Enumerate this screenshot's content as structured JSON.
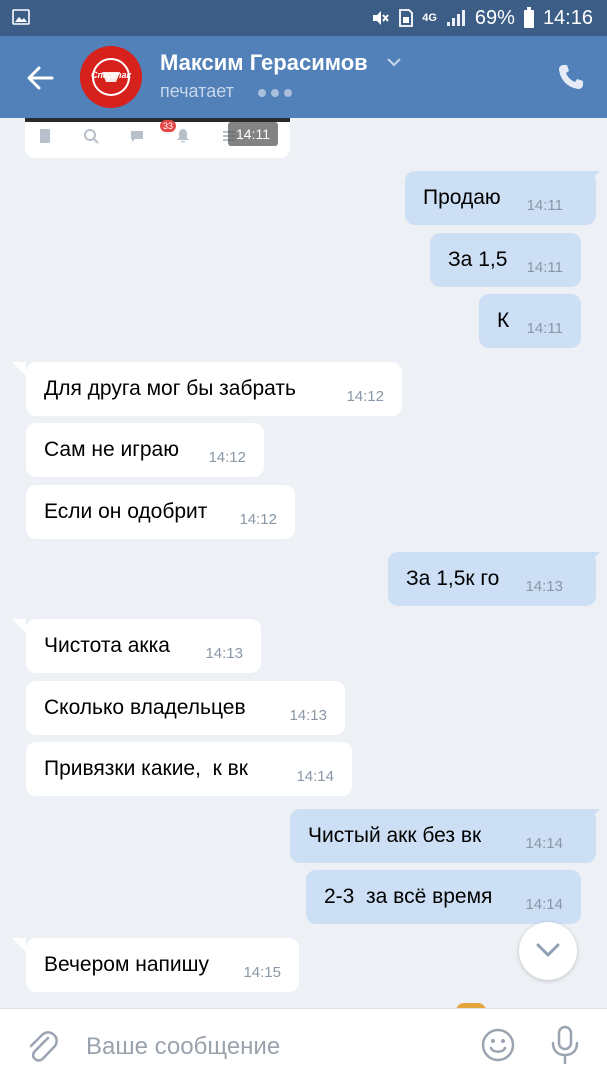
{
  "status_bar": {
    "network": "4G",
    "battery": "69%",
    "time": "14:16",
    "icons": [
      "image-icon",
      "mute-icon",
      "sim-icon",
      "signal-icon",
      "battery-icon"
    ]
  },
  "header": {
    "contact_name": "Максим Герасимов",
    "status": "печатает",
    "avatar_text": "Спартак",
    "icons": [
      "back-arrow-icon",
      "chevron-down-icon",
      "phone-icon"
    ]
  },
  "preview": {
    "badge": "33",
    "time": "14:11",
    "icons": [
      "news-icon",
      "search-icon",
      "messages-icon",
      "bell-icon",
      "menu-icon"
    ]
  },
  "messages": [
    {
      "dir": "out",
      "text": "Продаю",
      "time": "14:11"
    },
    {
      "dir": "out",
      "text": "За 1,5",
      "time": "14:11"
    },
    {
      "dir": "out",
      "text": "К",
      "time": "14:11"
    },
    {
      "dir": "in",
      "text": "Для друга мог бы забрать",
      "time": "14:12"
    },
    {
      "dir": "in",
      "text": "Сам не играю",
      "time": "14:12"
    },
    {
      "dir": "in",
      "text": "Если он одобрит",
      "time": "14:12"
    },
    {
      "dir": "out",
      "text": "За 1,5к го",
      "time": "14:13"
    },
    {
      "dir": "in",
      "text": "Чистота акка",
      "time": "14:13"
    },
    {
      "dir": "in",
      "text": "Сколько владельцев",
      "time": "14:13"
    },
    {
      "dir": "in",
      "text": "Привязки какие,  к вк",
      "time": "14:14"
    },
    {
      "dir": "out",
      "text": "Чистый акк без вк",
      "time": "14:14"
    },
    {
      "dir": "out",
      "text": "2-3  за всё время",
      "time": "14:14"
    },
    {
      "dir": "in",
      "text": "Вечером напишу",
      "time": "14:15"
    }
  ],
  "input": {
    "placeholder": "Ваше сообщение",
    "icons": [
      "attach-icon",
      "emoji-icon",
      "microphone-icon"
    ]
  },
  "colors": {
    "header": "#5181b8",
    "status_bar": "#3c5e86",
    "background": "#edf0f5",
    "outgoing_bubble": "#cddff4",
    "incoming_bubble": "#ffffff"
  }
}
